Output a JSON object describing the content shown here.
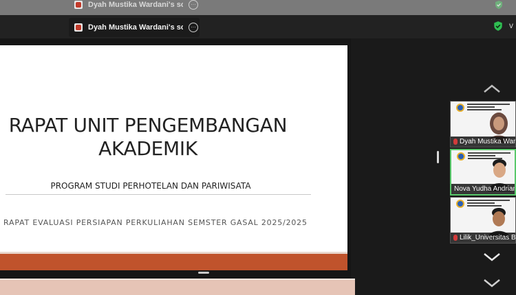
{
  "window": {
    "share_title": "Dyah Mustika Wardani's screen",
    "ghost_share_title": "Dyah Mustika Wardani's screen",
    "more_glyph": "···",
    "caret_glyph": "v"
  },
  "slide": {
    "title_line1": "RAPAT UNIT PENGEMBANGAN",
    "title_line2": "AKADEMIK",
    "subtitle": "PROGRAM STUDI PERHOTELAN DAN PARIWISATA",
    "event": "RAPAT EVALUASI PERSIAPAN PERKULIAHAN SEMSTER GASAL 2025/2025",
    "accent_color": "#c0532c"
  },
  "participants": [
    {
      "name": "Dyah Mustika Wardani",
      "muted": true,
      "active": false
    },
    {
      "name": "Nova Yudha Andrianso",
      "muted": false,
      "active": true
    },
    {
      "name": "Lilik_Universitas Bali",
      "muted": true,
      "active": false
    }
  ],
  "icons": {
    "security": "shield-check-icon",
    "scroll_up": "chevron-up-icon",
    "scroll_down": "chevron-down-icon",
    "more": "more-options-icon"
  },
  "colors": {
    "active_border": "#58c86a",
    "secure_green": "#2fbf52"
  }
}
